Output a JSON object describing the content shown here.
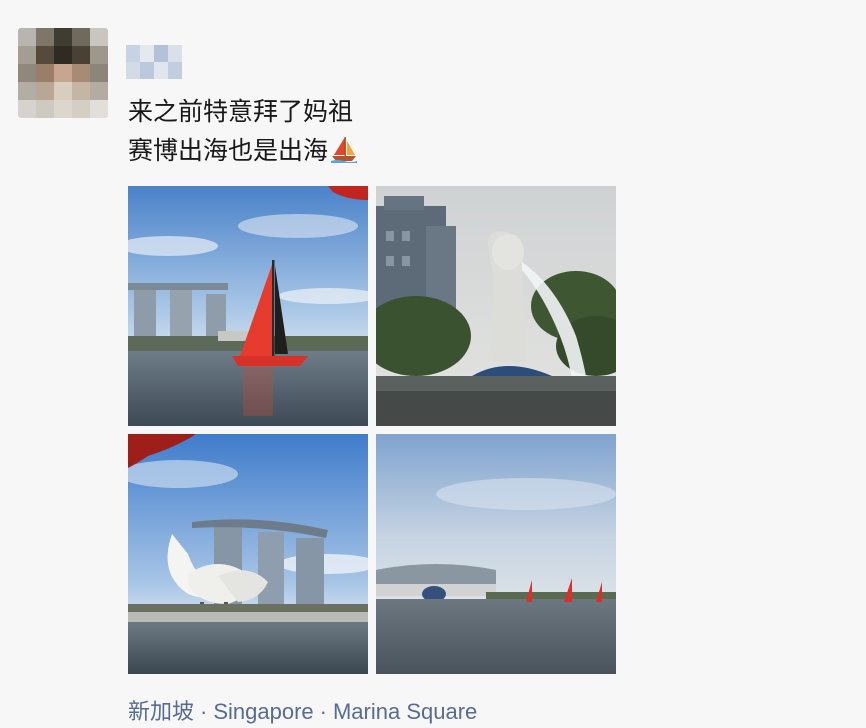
{
  "post": {
    "lines": [
      "来之前特意拜了妈祖",
      "赛博出海也是出海"
    ],
    "emoji": "sailboat-icon"
  },
  "photos": [
    "photo-sailboat-marina-bay",
    "photo-merlion-fountain",
    "photo-artscience-museum",
    "photo-harbor-sailboats"
  ],
  "location": {
    "city": "新加坡",
    "separator": "·",
    "country": "Singapore",
    "place": "Marina Square"
  },
  "colors": {
    "link": "#576b95",
    "text": "#191919",
    "background": "#f7f7f7"
  }
}
